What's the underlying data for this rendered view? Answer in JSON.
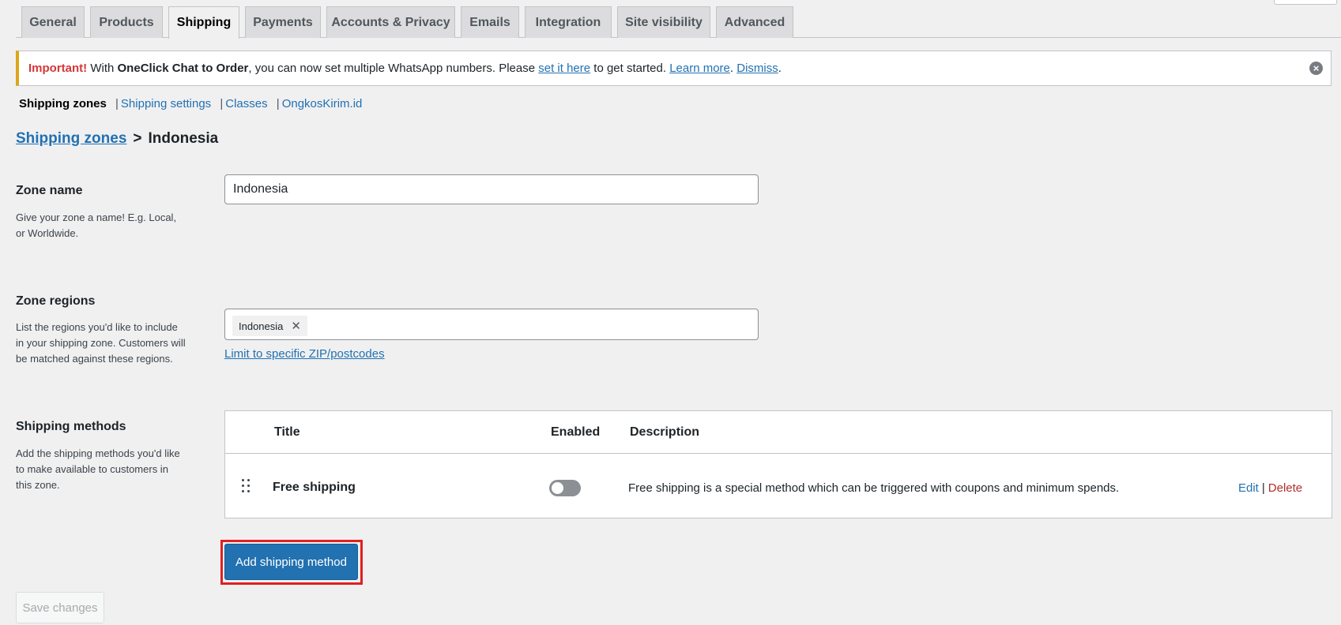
{
  "tabs": [
    {
      "label": "General"
    },
    {
      "label": "Products"
    },
    {
      "label": "Shipping"
    },
    {
      "label": "Payments"
    },
    {
      "label": "Accounts & Privacy"
    },
    {
      "label": "Emails"
    },
    {
      "label": "Integration"
    },
    {
      "label": "Site visibility"
    },
    {
      "label": "Advanced"
    }
  ],
  "active_tab": "Shipping",
  "notice": {
    "important": "Important!",
    "text_1": " With ",
    "plugin": "OneClick Chat to Order",
    "text_2": ", you can now set multiple WhatsApp numbers. Please ",
    "set_link": "set it here",
    "text_3": " to get started. ",
    "learn_link": "Learn more",
    "text_4": ". ",
    "dismiss_link": "Dismiss",
    "text_5": ".",
    "close_icon": "×"
  },
  "subnav": {
    "current": "Shipping zones",
    "items": [
      "Shipping settings",
      "Classes",
      "OngkosKirim.id"
    ],
    "separator": "|"
  },
  "breadcrumb": {
    "link": "Shipping zones",
    "separator": ">",
    "current": "Indonesia"
  },
  "zone_name": {
    "label": "Zone name",
    "description_line1": "Give your zone a name! E.g. Local,",
    "description_line2": "or Worldwide.",
    "value": "Indonesia"
  },
  "zone_regions": {
    "label": "Zone regions",
    "description_line1": "List the regions you'd like to include",
    "description_line2": "in your shipping zone. Customers will",
    "description_line3": "be matched against these regions.",
    "chip": "Indonesia",
    "chip_remove": "✕",
    "zip_link": "Limit to specific ZIP/postcodes"
  },
  "shipping_methods": {
    "label": "Shipping methods",
    "description_line1": "Add the shipping methods you'd like",
    "description_line2": "to make available to customers in",
    "description_line3": "this zone.",
    "columns": {
      "title": "Title",
      "enabled": "Enabled",
      "description": "Description"
    },
    "rows": [
      {
        "title": "Free shipping",
        "enabled": false,
        "description": "Free shipping is a special method which can be triggered with coupons and minimum spends.",
        "edit": "Edit",
        "sep": "|",
        "delete": "Delete"
      }
    ]
  },
  "buttons": {
    "add_method": "Add shipping method",
    "save": "Save changes"
  },
  "colors": {
    "accent": "#2271b1",
    "danger": "#b32d2e",
    "highlight": "#e02020",
    "notice_border": "#dba617"
  }
}
